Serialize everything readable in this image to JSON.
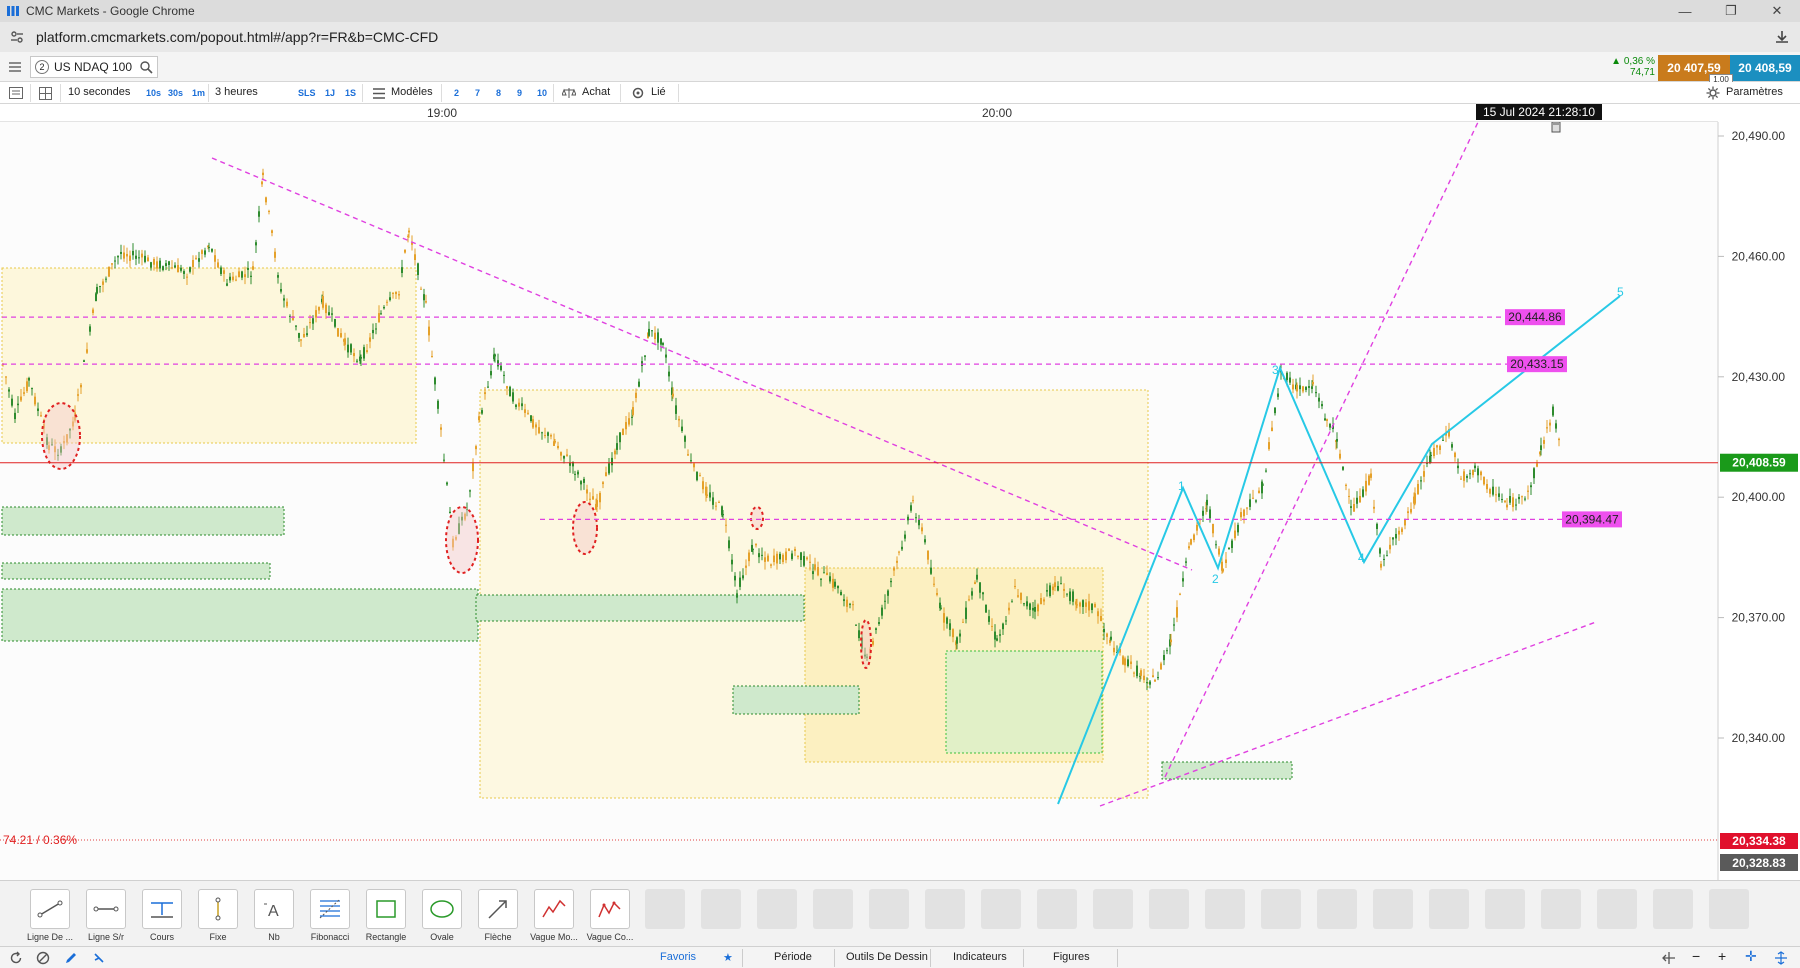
{
  "window": {
    "title": "CMC Markets - Google Chrome"
  },
  "browser": {
    "url": "platform.cmcmarkets.com/popout.html#/app?r=FR&b=CMC-CFD"
  },
  "instrument": {
    "number": "2",
    "name": "US NDAQ 100"
  },
  "quote": {
    "change_pct": "0,36 %",
    "change_abs": "74,71",
    "sell": "20 407,59",
    "buy": "20 408,59",
    "spread": "1.00"
  },
  "toolbar": {
    "interval": "10 secondes",
    "int_10s": "10s",
    "int_30s": "30s",
    "int_1m": "1m",
    "range": "3 heures",
    "sls": "SLS",
    "r1j": "1J",
    "r1s": "1S",
    "models": "Modèles",
    "n2": "2",
    "n7": "7",
    "n8": "8",
    "n9": "9",
    "n10": "10",
    "achat": "Achat",
    "lie": "Lié",
    "params": "Paramètres"
  },
  "time_axis": {
    "t1": "19:00",
    "t2": "20:00",
    "cursor": "15 Jul 2024 21:28:10"
  },
  "chart_data": {
    "type": "candlestick",
    "y_ticks": [
      "20,490.00",
      "20,460.00",
      "20,430.00",
      "20,400.00",
      "20,370.00",
      "20,340.00"
    ],
    "ylim": [
      20327,
      20492
    ],
    "current_price": "20,408.59",
    "levels": [
      {
        "label": "20,444.86",
        "value": 20444.86
      },
      {
        "label": "20,433.15",
        "value": 20433.15
      },
      {
        "label": "20,394.47",
        "value": 20394.47
      }
    ],
    "low_line_label": "20,334.38",
    "bottom_label": "20,328.83",
    "change_label": "74.21 / 0.36%",
    "wave_labels": [
      "1",
      "2",
      "3",
      "4",
      "5"
    ]
  },
  "tools": [
    {
      "label": "Ligne De ...",
      "icon": "line-tool-icon"
    },
    {
      "label": "Ligne S/r",
      "icon": "sr-line-icon"
    },
    {
      "label": "Cours",
      "icon": "price-icon"
    },
    {
      "label": "Fixe",
      "icon": "fixed-icon"
    },
    {
      "label": "Nb",
      "icon": "text-icon"
    },
    {
      "label": "Fibonacci",
      "icon": "fibonacci-icon"
    },
    {
      "label": "Rectangle",
      "icon": "rectangle-icon"
    },
    {
      "label": "Ovale",
      "icon": "oval-icon"
    },
    {
      "label": "Flèche",
      "icon": "arrow-icon"
    },
    {
      "label": "Vague Mo...",
      "icon": "wave-icon"
    },
    {
      "label": "Vague Co...",
      "icon": "wave-corrective-icon"
    }
  ],
  "nb_glyph": "A",
  "bottom_tabs": {
    "fav": "Favoris",
    "periode": "Période",
    "outils": "Outils De Dessin",
    "indicateurs": "Indicateurs",
    "figures": "Figures"
  }
}
